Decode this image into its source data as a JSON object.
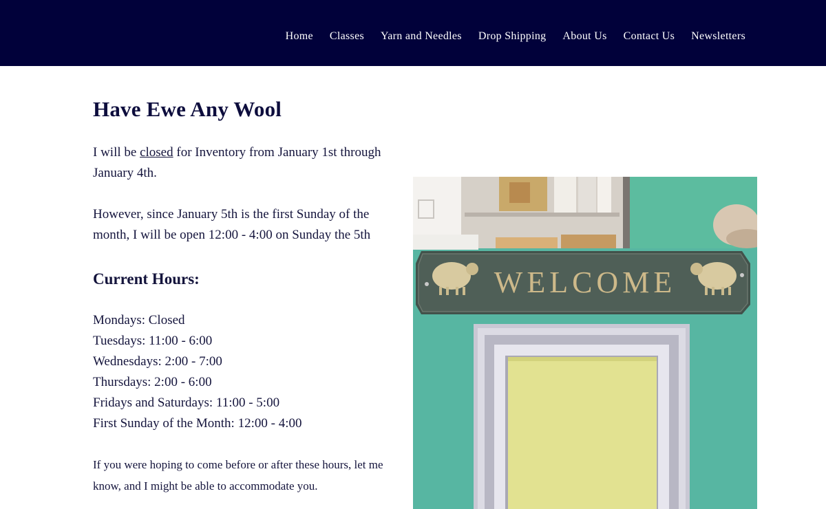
{
  "nav": {
    "items": [
      {
        "id": "home",
        "label": "Home"
      },
      {
        "id": "classes",
        "label": "Classes"
      },
      {
        "id": "yarn",
        "label": "Yarn and Needles"
      },
      {
        "id": "drop",
        "label": "Drop Shipping"
      },
      {
        "id": "about",
        "label": "About Us"
      },
      {
        "id": "contact",
        "label": "Contact Us"
      },
      {
        "id": "news",
        "label": "Newsletters"
      }
    ]
  },
  "main": {
    "title": "Have Ewe Any Wool",
    "notice": {
      "prefix": "I will be ",
      "link": "closed",
      "suffix": " for Inventory from January 1st through January 4th."
    },
    "sunday_note": "However, since January 5th is the first Sunday of the month, I will be open 12:00 - 4:00 on Sunday the 5th",
    "hours_heading": "Current Hours:",
    "hours": [
      "Mondays: Closed",
      "Tuesdays: 11:00 - 6:00",
      "Wednesdays: 2:00 - 7:00",
      "Thursdays: 2:00 - 6:00",
      "Fridays and Saturdays: 11:00 - 5:00",
      "First Sunday of the Month: 12:00 - 4:00"
    ],
    "accommodate": "If you were hoping to come before or after these hours, let me know, and I might be able to accommodate you."
  },
  "photo": {
    "sign_text": "WELCOME",
    "colors": {
      "wall": "#57b6a2",
      "sign": "#4b5a52",
      "sign_text": "#cdb98a",
      "frame": "#c9c8d4",
      "panel": "#e2e291"
    }
  }
}
